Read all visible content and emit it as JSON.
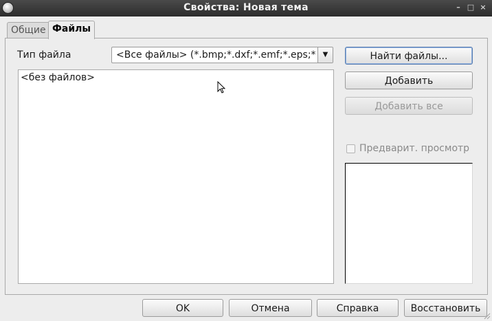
{
  "window": {
    "title": "Свойства: Новая тема",
    "controls": {
      "minimize": "–",
      "maximize": "□",
      "close": "×"
    }
  },
  "tabs": [
    {
      "label": "Общие",
      "active": false
    },
    {
      "label": "Файлы",
      "active": true
    }
  ],
  "files_tab": {
    "file_type_label": "Тип файла",
    "file_type_value": "<Все файлы> (*.bmp;*.dxf;*.emf;*.eps;*.",
    "file_list_empty": "<без файлов>",
    "buttons": {
      "find_files": "Найти файлы...",
      "add": "Добавить",
      "add_all": "Добавить все"
    },
    "preview_label": "Предварит. просмотр",
    "preview_checked": false
  },
  "footer": {
    "ok": "OK",
    "cancel": "Отмена",
    "help": "Справка",
    "reset": "Восстановить"
  },
  "icons": [
    "app-icon",
    "minimize-icon",
    "maximize-icon",
    "close-icon",
    "chevron-down-icon",
    "mouse-cursor-icon"
  ]
}
